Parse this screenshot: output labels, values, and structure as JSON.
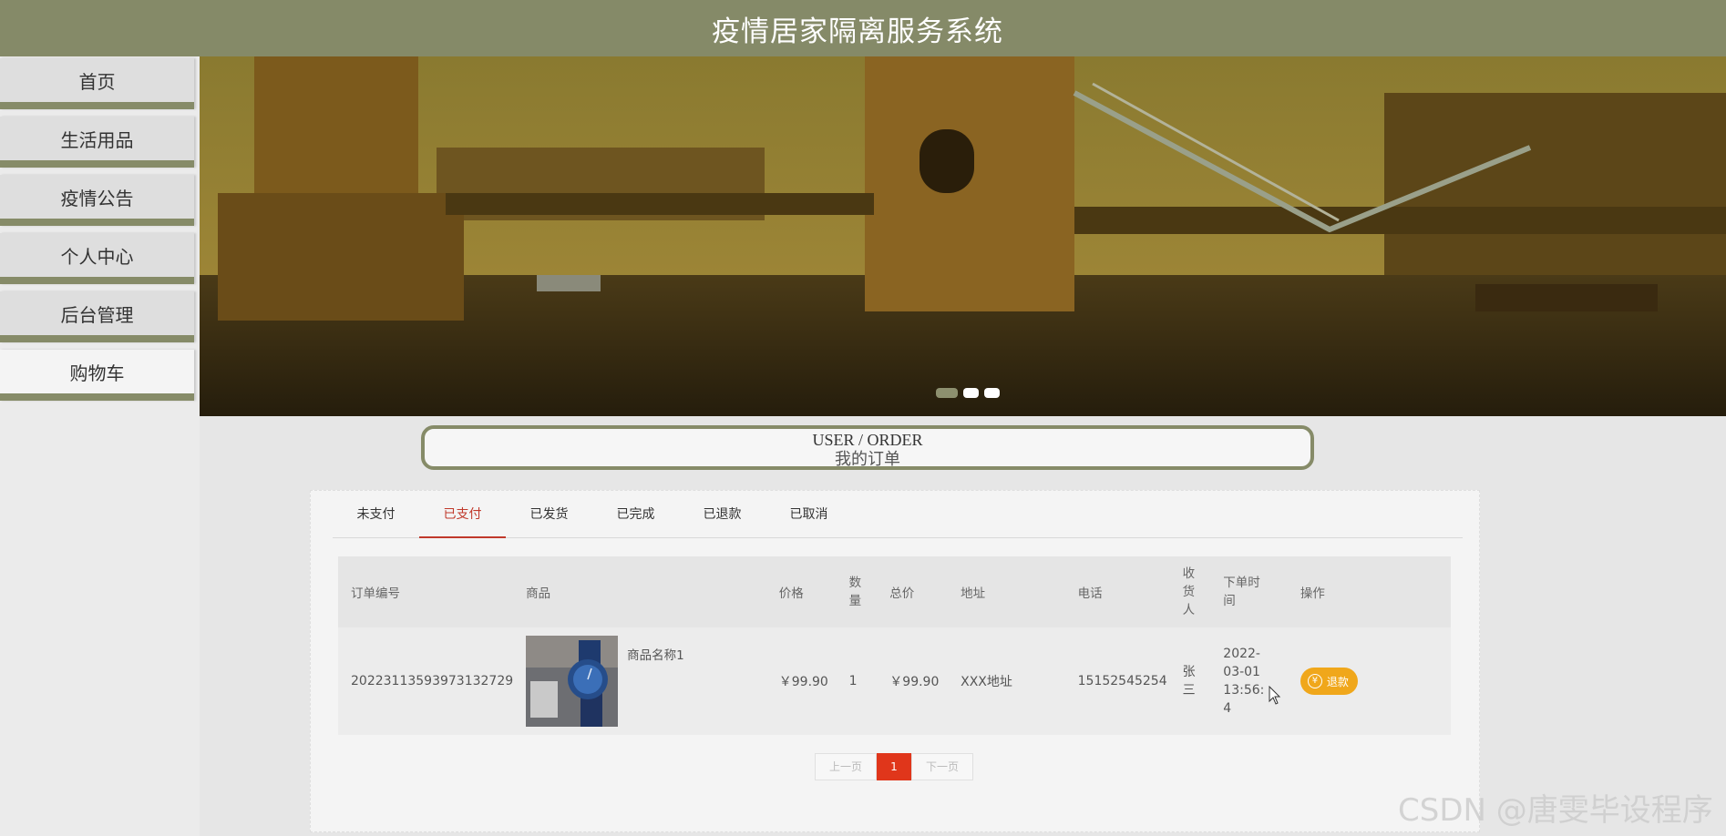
{
  "header": {
    "title": "疫情居家隔离服务系统"
  },
  "sidebar": {
    "items": [
      {
        "label": "首页",
        "active": false
      },
      {
        "label": "生活用品",
        "active": false
      },
      {
        "label": "疫情公告",
        "active": false
      },
      {
        "label": "个人中心",
        "active": false
      },
      {
        "label": "后台管理",
        "active": false
      },
      {
        "label": "购物车",
        "active": true
      }
    ]
  },
  "banner": {
    "slides": 3,
    "active_slide": 1
  },
  "section": {
    "title_en": "USER / ORDER",
    "title_cn": "我的订单"
  },
  "tabs": [
    {
      "label": "未支付",
      "active": false
    },
    {
      "label": "已支付",
      "active": true
    },
    {
      "label": "已发货",
      "active": false
    },
    {
      "label": "已完成",
      "active": false
    },
    {
      "label": "已退款",
      "active": false
    },
    {
      "label": "已取消",
      "active": false
    }
  ],
  "table": {
    "headers": {
      "order_no": "订单编号",
      "product": "商品",
      "price": "价格",
      "qty": "数量",
      "total": "总价",
      "address": "地址",
      "phone": "电话",
      "receiver": "收货人",
      "order_time": "下单时间",
      "action": "操作"
    },
    "rows": [
      {
        "order_no": "20223113593973132729",
        "product_name": "商品名称1",
        "price": "￥99.90",
        "qty": "1",
        "total": "￥99.90",
        "address": "XXX地址",
        "phone": "15152545254",
        "receiver": "张三",
        "order_time": "2022-03-01 13:56:4",
        "action_label": "退款"
      }
    ]
  },
  "pagination": {
    "prev": "上一页",
    "current": "1",
    "next": "下一页"
  },
  "watermark": "CSDN @唐雯毕设程序",
  "colors": {
    "theme": "#858a68",
    "active_tab": "#c0392b",
    "refund": "#f0a71b",
    "page_current": "#e0361b"
  }
}
